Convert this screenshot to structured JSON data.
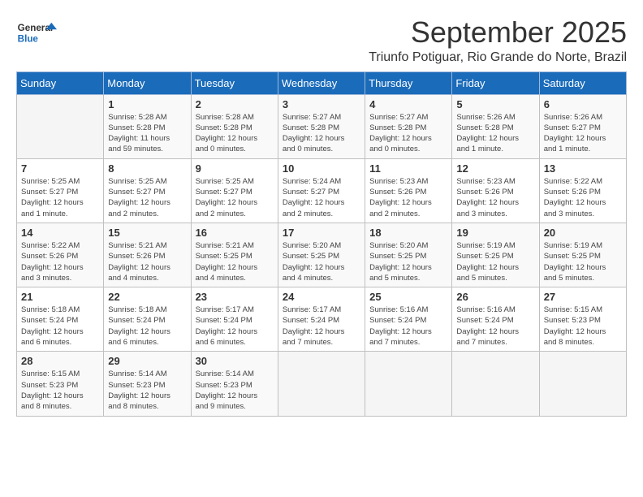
{
  "header": {
    "logo_general": "General",
    "logo_blue": "Blue",
    "month_year": "September 2025",
    "location": "Triunfo Potiguar, Rio Grande do Norte, Brazil"
  },
  "calendar": {
    "columns": [
      "Sunday",
      "Monday",
      "Tuesday",
      "Wednesday",
      "Thursday",
      "Friday",
      "Saturday"
    ],
    "weeks": [
      [
        {
          "day": "",
          "info": ""
        },
        {
          "day": "1",
          "info": "Sunrise: 5:28 AM\nSunset: 5:28 PM\nDaylight: 11 hours\nand 59 minutes."
        },
        {
          "day": "2",
          "info": "Sunrise: 5:28 AM\nSunset: 5:28 PM\nDaylight: 12 hours\nand 0 minutes."
        },
        {
          "day": "3",
          "info": "Sunrise: 5:27 AM\nSunset: 5:28 PM\nDaylight: 12 hours\nand 0 minutes."
        },
        {
          "day": "4",
          "info": "Sunrise: 5:27 AM\nSunset: 5:28 PM\nDaylight: 12 hours\nand 0 minutes."
        },
        {
          "day": "5",
          "info": "Sunrise: 5:26 AM\nSunset: 5:28 PM\nDaylight: 12 hours\nand 1 minute."
        },
        {
          "day": "6",
          "info": "Sunrise: 5:26 AM\nSunset: 5:27 PM\nDaylight: 12 hours\nand 1 minute."
        }
      ],
      [
        {
          "day": "7",
          "info": "Sunrise: 5:25 AM\nSunset: 5:27 PM\nDaylight: 12 hours\nand 1 minute."
        },
        {
          "day": "8",
          "info": "Sunrise: 5:25 AM\nSunset: 5:27 PM\nDaylight: 12 hours\nand 2 minutes."
        },
        {
          "day": "9",
          "info": "Sunrise: 5:25 AM\nSunset: 5:27 PM\nDaylight: 12 hours\nand 2 minutes."
        },
        {
          "day": "10",
          "info": "Sunrise: 5:24 AM\nSunset: 5:27 PM\nDaylight: 12 hours\nand 2 minutes."
        },
        {
          "day": "11",
          "info": "Sunrise: 5:23 AM\nSunset: 5:26 PM\nDaylight: 12 hours\nand 2 minutes."
        },
        {
          "day": "12",
          "info": "Sunrise: 5:23 AM\nSunset: 5:26 PM\nDaylight: 12 hours\nand 3 minutes."
        },
        {
          "day": "13",
          "info": "Sunrise: 5:22 AM\nSunset: 5:26 PM\nDaylight: 12 hours\nand 3 minutes."
        }
      ],
      [
        {
          "day": "14",
          "info": "Sunrise: 5:22 AM\nSunset: 5:26 PM\nDaylight: 12 hours\nand 3 minutes."
        },
        {
          "day": "15",
          "info": "Sunrise: 5:21 AM\nSunset: 5:26 PM\nDaylight: 12 hours\nand 4 minutes."
        },
        {
          "day": "16",
          "info": "Sunrise: 5:21 AM\nSunset: 5:25 PM\nDaylight: 12 hours\nand 4 minutes."
        },
        {
          "day": "17",
          "info": "Sunrise: 5:20 AM\nSunset: 5:25 PM\nDaylight: 12 hours\nand 4 minutes."
        },
        {
          "day": "18",
          "info": "Sunrise: 5:20 AM\nSunset: 5:25 PM\nDaylight: 12 hours\nand 5 minutes."
        },
        {
          "day": "19",
          "info": "Sunrise: 5:19 AM\nSunset: 5:25 PM\nDaylight: 12 hours\nand 5 minutes."
        },
        {
          "day": "20",
          "info": "Sunrise: 5:19 AM\nSunset: 5:25 PM\nDaylight: 12 hours\nand 5 minutes."
        }
      ],
      [
        {
          "day": "21",
          "info": "Sunrise: 5:18 AM\nSunset: 5:24 PM\nDaylight: 12 hours\nand 6 minutes."
        },
        {
          "day": "22",
          "info": "Sunrise: 5:18 AM\nSunset: 5:24 PM\nDaylight: 12 hours\nand 6 minutes."
        },
        {
          "day": "23",
          "info": "Sunrise: 5:17 AM\nSunset: 5:24 PM\nDaylight: 12 hours\nand 6 minutes."
        },
        {
          "day": "24",
          "info": "Sunrise: 5:17 AM\nSunset: 5:24 PM\nDaylight: 12 hours\nand 7 minutes."
        },
        {
          "day": "25",
          "info": "Sunrise: 5:16 AM\nSunset: 5:24 PM\nDaylight: 12 hours\nand 7 minutes."
        },
        {
          "day": "26",
          "info": "Sunrise: 5:16 AM\nSunset: 5:24 PM\nDaylight: 12 hours\nand 7 minutes."
        },
        {
          "day": "27",
          "info": "Sunrise: 5:15 AM\nSunset: 5:23 PM\nDaylight: 12 hours\nand 8 minutes."
        }
      ],
      [
        {
          "day": "28",
          "info": "Sunrise: 5:15 AM\nSunset: 5:23 PM\nDaylight: 12 hours\nand 8 minutes."
        },
        {
          "day": "29",
          "info": "Sunrise: 5:14 AM\nSunset: 5:23 PM\nDaylight: 12 hours\nand 8 minutes."
        },
        {
          "day": "30",
          "info": "Sunrise: 5:14 AM\nSunset: 5:23 PM\nDaylight: 12 hours\nand 9 minutes."
        },
        {
          "day": "",
          "info": ""
        },
        {
          "day": "",
          "info": ""
        },
        {
          "day": "",
          "info": ""
        },
        {
          "day": "",
          "info": ""
        }
      ]
    ]
  }
}
